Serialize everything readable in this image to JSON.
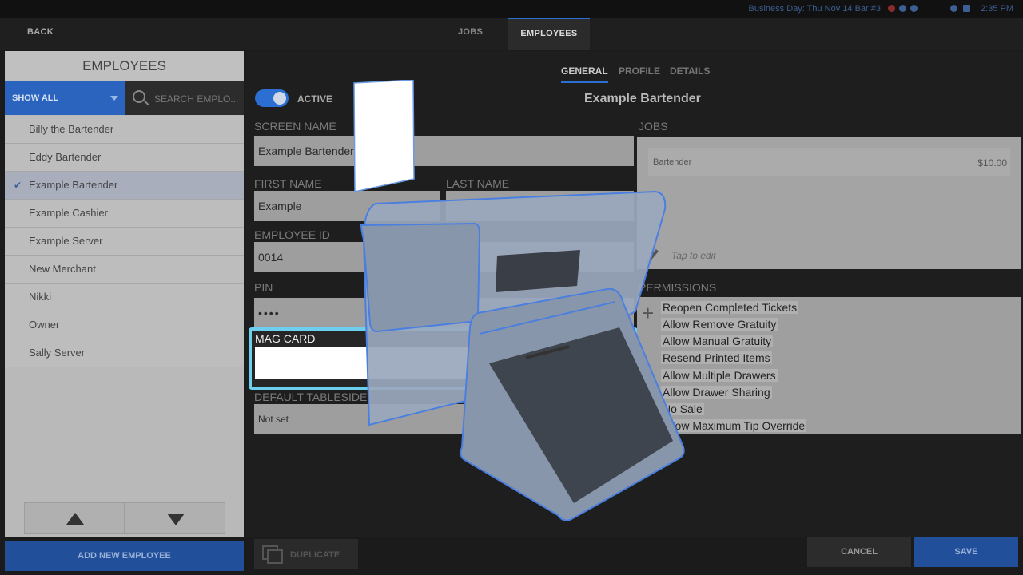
{
  "status_bar": {
    "business_day": "Business Day: Thu Nov 14  Bar  #3",
    "time": "2:35 PM"
  },
  "nav": {
    "back": "BACK",
    "tabs": [
      {
        "label": "JOBS"
      },
      {
        "label": "EMPLOYEES",
        "active": true
      }
    ]
  },
  "left_panel": {
    "title": "EMPLOYEES",
    "filter": "SHOW ALL",
    "search_placeholder": "SEARCH EMPLO...",
    "employees": [
      {
        "name": "Billy the Bartender"
      },
      {
        "name": "Eddy Bartender"
      },
      {
        "name": "Example Bartender",
        "selected": true,
        "check": "✔"
      },
      {
        "name": "Example Cashier"
      },
      {
        "name": "Example Server"
      },
      {
        "name": "New Merchant"
      },
      {
        "name": "Nikki"
      },
      {
        "name": "Owner"
      },
      {
        "name": "Sally Server"
      }
    ],
    "add_new": "ADD NEW EMPLOYEE"
  },
  "detail": {
    "subtabs": [
      "GENERAL",
      "PROFILE",
      "DETAILS"
    ],
    "active_label": "ACTIVE",
    "employee_name": "Example Bartender",
    "screen_name_label": "SCREEN NAME",
    "screen_name": "Example Bartender",
    "first_name_label": "FIRST NAME",
    "first_name": "Example",
    "last_name_label": "LAST NAME",
    "employee_id_label": "EMPLOYEE ID",
    "employee_id": "0014",
    "pin_label": "PIN",
    "pin": "••••",
    "mag_card_label": "MAG CARD",
    "tableside_label": "DEFAULT TABLESIDE",
    "tableside_value": "Not set",
    "jobs_label": "JOBS",
    "job": {
      "name": "Bartender",
      "rate": "$10.00"
    },
    "tap_to_edit": "Tap to edit",
    "permissions_label": "PERMISSIONS",
    "permissions": [
      "Reopen Completed Tickets",
      "Allow Remove Gratuity",
      "Allow Manual Gratuity",
      "Resend Printed Items",
      "Allow Multiple Drawers",
      "Allow Drawer Sharing",
      "No Sale",
      "Allow Maximum Tip Override"
    ],
    "duplicate": "DUPLICATE",
    "cancel": "CANCEL",
    "save": "SAVE"
  },
  "colors": {
    "accent": "#2a6fd1",
    "highlight": "#6ccfee"
  }
}
